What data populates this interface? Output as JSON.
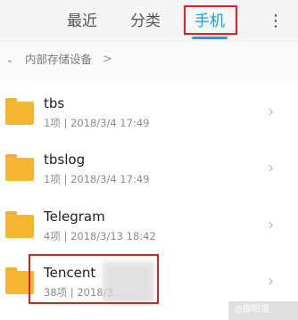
{
  "tabs": {
    "recent": "最近",
    "category": "分类",
    "phone": "手机"
  },
  "toolbar": {
    "more_glyph": "⋮"
  },
  "breadcrumb": {
    "chevron": "⌄",
    "label": "内部存储设备",
    "arrow": ">"
  },
  "folders": [
    {
      "name": "tbs",
      "meta": "1项 | 2018/3/4 17:49"
    },
    {
      "name": "tbslog",
      "meta": "1项 | 2018/3/4 17:49"
    },
    {
      "name": "Telegram",
      "meta": "4项 | 2018/3/13 18:42"
    },
    {
      "name": "Tencent",
      "meta": "38项 | 2018/3"
    }
  ],
  "row_arrow": "›",
  "watermark": "@邵阳哥",
  "colors": {
    "accent": "#1aa0e8",
    "highlight": "#e02020",
    "folder": "#f6b631"
  }
}
